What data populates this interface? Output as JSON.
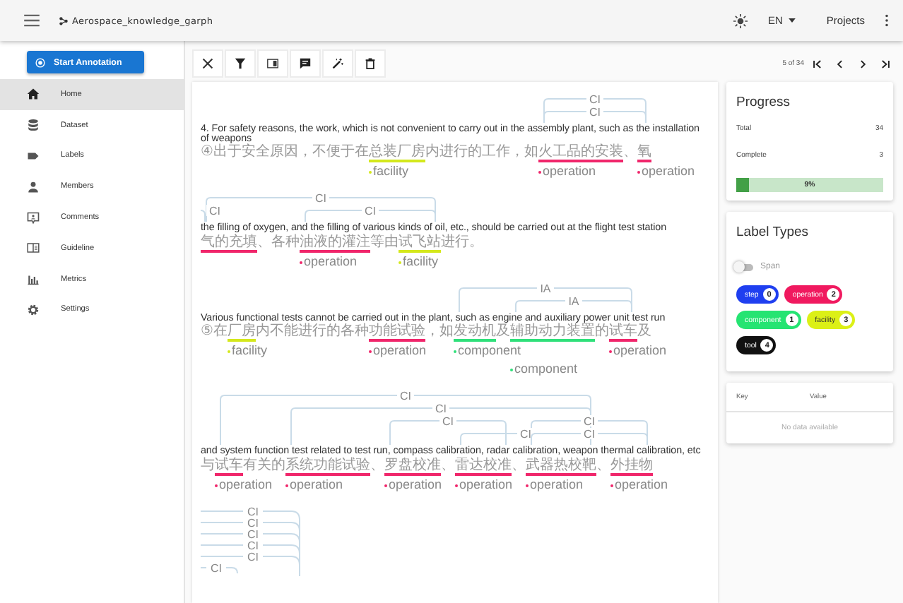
{
  "app_bar": {
    "title": "Aerospace_knowledge_garph",
    "language": "EN",
    "projects": "Projects"
  },
  "sidebar": {
    "start_button": "Start Annotation",
    "items": [
      {
        "label": "Home",
        "kind": "home",
        "selected": true
      },
      {
        "label": "Dataset",
        "kind": "database",
        "selected": false
      },
      {
        "label": "Labels",
        "kind": "label",
        "selected": false
      },
      {
        "label": "Members",
        "kind": "person",
        "selected": false
      },
      {
        "label": "Comments",
        "kind": "comment",
        "selected": false
      },
      {
        "label": "Guideline",
        "kind": "guide",
        "selected": false
      },
      {
        "label": "Metrics",
        "kind": "chart",
        "selected": false
      },
      {
        "label": "Settings",
        "kind": "gear",
        "selected": false
      }
    ]
  },
  "document": {
    "blocks": [
      {
        "english": "4. For safety reasons, the work, which is not convenient to carry out in the assembly plant, such as the installation of weapons",
        "segments": [
          {
            "text": "④出于安全原因，不便于在"
          },
          {
            "text": "总装厂房",
            "label": "facility",
            "color": "#d4e81c"
          },
          {
            "text": "内进行的工作，如"
          },
          {
            "text": "火工品的安装",
            "label": "operation",
            "color": "#f0266b"
          },
          {
            "text": "、"
          },
          {
            "text": "氧",
            "label": "operation",
            "color": "#f0266b"
          }
        ],
        "relations": [
          "CI",
          "CI"
        ]
      },
      {
        "english": "the filling of oxygen, and the filling of various kinds of oil, etc., should be carried out at  the flight test station",
        "segments": [
          {
            "text": "气的充填",
            "color": "#f0266b"
          },
          {
            "text": "、各种"
          },
          {
            "text": "油液的灌注",
            "label": "operation",
            "color": "#f0266b"
          },
          {
            "text": "等由"
          },
          {
            "text": "试飞站",
            "label": "facility",
            "color": "#d4e81c"
          },
          {
            "text": "进行。"
          }
        ],
        "relations": [
          "CI",
          "CI",
          "CI"
        ]
      },
      {
        "english": "Various functional tests cannot be carried out in the plant, such as engine and auxiliary power unit test run",
        "segments": [
          {
            "text": "⑤在"
          },
          {
            "text": "厂房",
            "label": "facility",
            "color": "#d4e81c"
          },
          {
            "text": "内不能进行的各种"
          },
          {
            "text": "功能试验",
            "label": "operation",
            "color": "#f0266b"
          },
          {
            "text": "，如"
          },
          {
            "text": "发动机",
            "label": "component",
            "color": "#2fe07a"
          },
          {
            "text": "及"
          },
          {
            "text": "辅助动力装置",
            "label": "component",
            "color": "#2fe07a"
          },
          {
            "text": "的"
          },
          {
            "text": "试车",
            "label": "operation",
            "color": "#f0266b"
          },
          {
            "text": "及"
          }
        ],
        "relations": [
          "IA",
          "IA"
        ]
      },
      {
        "english": "and system function test related to test run, compass calibration, radar calibration, weapon thermal calibration, etc",
        "segments": [
          {
            "text": "与"
          },
          {
            "text": "试车",
            "label": "operation",
            "color": "#f0266b"
          },
          {
            "text": "有关的"
          },
          {
            "text": "系统功能试验",
            "label": "operation",
            "color": "#f0266b"
          },
          {
            "text": "、"
          },
          {
            "text": "罗盘校准",
            "label": "operation",
            "color": "#f0266b"
          },
          {
            "text": "、"
          },
          {
            "text": "雷达校准",
            "label": "operation",
            "color": "#f0266b"
          },
          {
            "text": "、"
          },
          {
            "text": "武器热校靶",
            "label": "operation",
            "color": "#f0266b"
          },
          {
            "text": "、"
          },
          {
            "text": "外挂物",
            "label": "operation",
            "color": "#f0266b"
          }
        ],
        "relations": [
          "CI",
          "CI",
          "CI",
          "CI",
          "CI",
          "CI"
        ]
      }
    ],
    "trailing_relations": [
      "CI",
      "CI",
      "CI",
      "CI",
      "CI",
      "CI"
    ]
  },
  "pager": {
    "text": "5 of 34"
  },
  "progress": {
    "title": "Progress",
    "rows": [
      {
        "label": "Total",
        "value": "34"
      },
      {
        "label": "Complete",
        "value": "3"
      }
    ],
    "level": 0.09,
    "percent": "9%"
  },
  "label_types": {
    "title": "Label Types",
    "switch": {
      "label": "Span",
      "on": false
    },
    "chips": [
      {
        "name": "step",
        "count": "0",
        "color": "#1f3ff0"
      },
      {
        "name": "operation",
        "count": "2",
        "color": "#f0195f"
      },
      {
        "name": "component",
        "count": "1",
        "color": "#25e472"
      },
      {
        "name": "facility",
        "count": "3",
        "color": "#dcf016"
      },
      {
        "name": "tool",
        "count": "4",
        "color": "#111111"
      }
    ]
  },
  "table": {
    "columns": [
      "Key",
      "Value"
    ],
    "empty": "No data available"
  }
}
